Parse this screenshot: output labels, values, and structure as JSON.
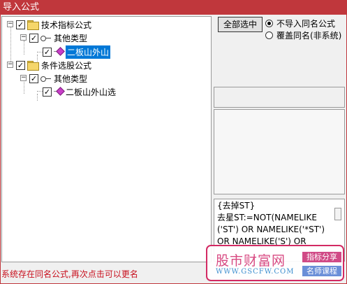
{
  "window": {
    "title": "导入公式"
  },
  "tree": {
    "nodes": [
      {
        "label": "技术指标公式"
      },
      {
        "label": "其他类型"
      },
      {
        "label": "二板山外山"
      },
      {
        "label": "条件选股公式"
      },
      {
        "label": "其他类型"
      },
      {
        "label": "二板山外山选"
      }
    ]
  },
  "options": {
    "select_all_label": "全部选中",
    "radio_skip": "不导入同名公式",
    "radio_overwrite": "覆盖同名(非系统)"
  },
  "formula": {
    "lines": [
      "{去掉ST}",
      "去星ST:=NOT(NAMELIKE",
      "('ST') OR NAMELIKE('*ST')",
      "OR NAMELIKE('S') OR"
    ]
  },
  "status": {
    "message": "系统存在同名公式,再次点击可以更名"
  },
  "watermark": {
    "name": "股市财富网",
    "url": "WWW.GSCFW.COM",
    "tag1": "指标分享",
    "tag2": "名师课程"
  },
  "colors": {
    "titlebar": "#c0373c",
    "selection": "#0078d7",
    "status_text": "#c8101e"
  }
}
